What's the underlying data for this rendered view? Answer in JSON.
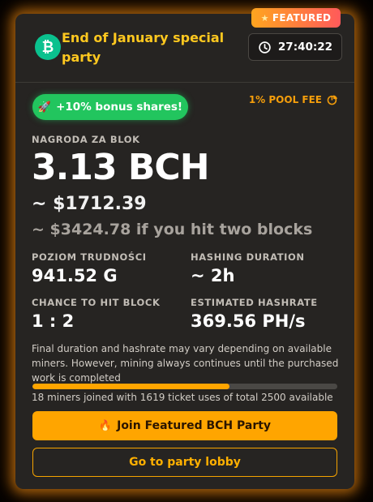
{
  "badge": {
    "label": "FEATURED",
    "icon": "star-icon"
  },
  "header": {
    "coin_symbol": "₿",
    "coin_icon": "bitcoin-cash-icon",
    "title": "End of January special party",
    "timer": "27:40:22",
    "timer_icon": "clock-icon"
  },
  "bonus": {
    "label": "+10% bonus shares!",
    "icon": "rocket-icon"
  },
  "pool_fee": {
    "label": "1% POOL FEE",
    "icon": "pie-chart-icon"
  },
  "reward": {
    "label": "NAGRODA ZA BLOK",
    "amount": "3.13 BCH",
    "usd": "~ $1712.39",
    "usd_two_value": "~ $3424.78",
    "usd_two_suffix": " if you hit two blocks"
  },
  "stats": {
    "difficulty_label": "POZIOM TRUDNOŚCI",
    "difficulty_value": "941.52 G",
    "duration_label": "HASHING DURATION",
    "duration_value": "~ 2h",
    "chance_label": "CHANCE TO HIT BLOCK",
    "chance_value": "1 : 2",
    "hashrate_label": "ESTIMATED HASHRATE",
    "hashrate_value": "369.56 PH/s"
  },
  "note": "Final duration and hashrate may vary depending on available miners. However, mining always continues until the purchased work is completed",
  "progress": {
    "used": 1619,
    "total": 2500,
    "fraction": 0.6476
  },
  "miners_text": "18 miners joined with 1619 ticket uses of total 2500 available",
  "buttons": {
    "join_label": "Join Featured BCH Party",
    "join_icon": "fire-icon",
    "lobby_label": "Go to party lobby"
  },
  "colors": {
    "accent": "#ffa500",
    "title": "#ffc81f",
    "bonus": "#22c55e",
    "card": "#262422",
    "bch": "#0ac18e"
  }
}
